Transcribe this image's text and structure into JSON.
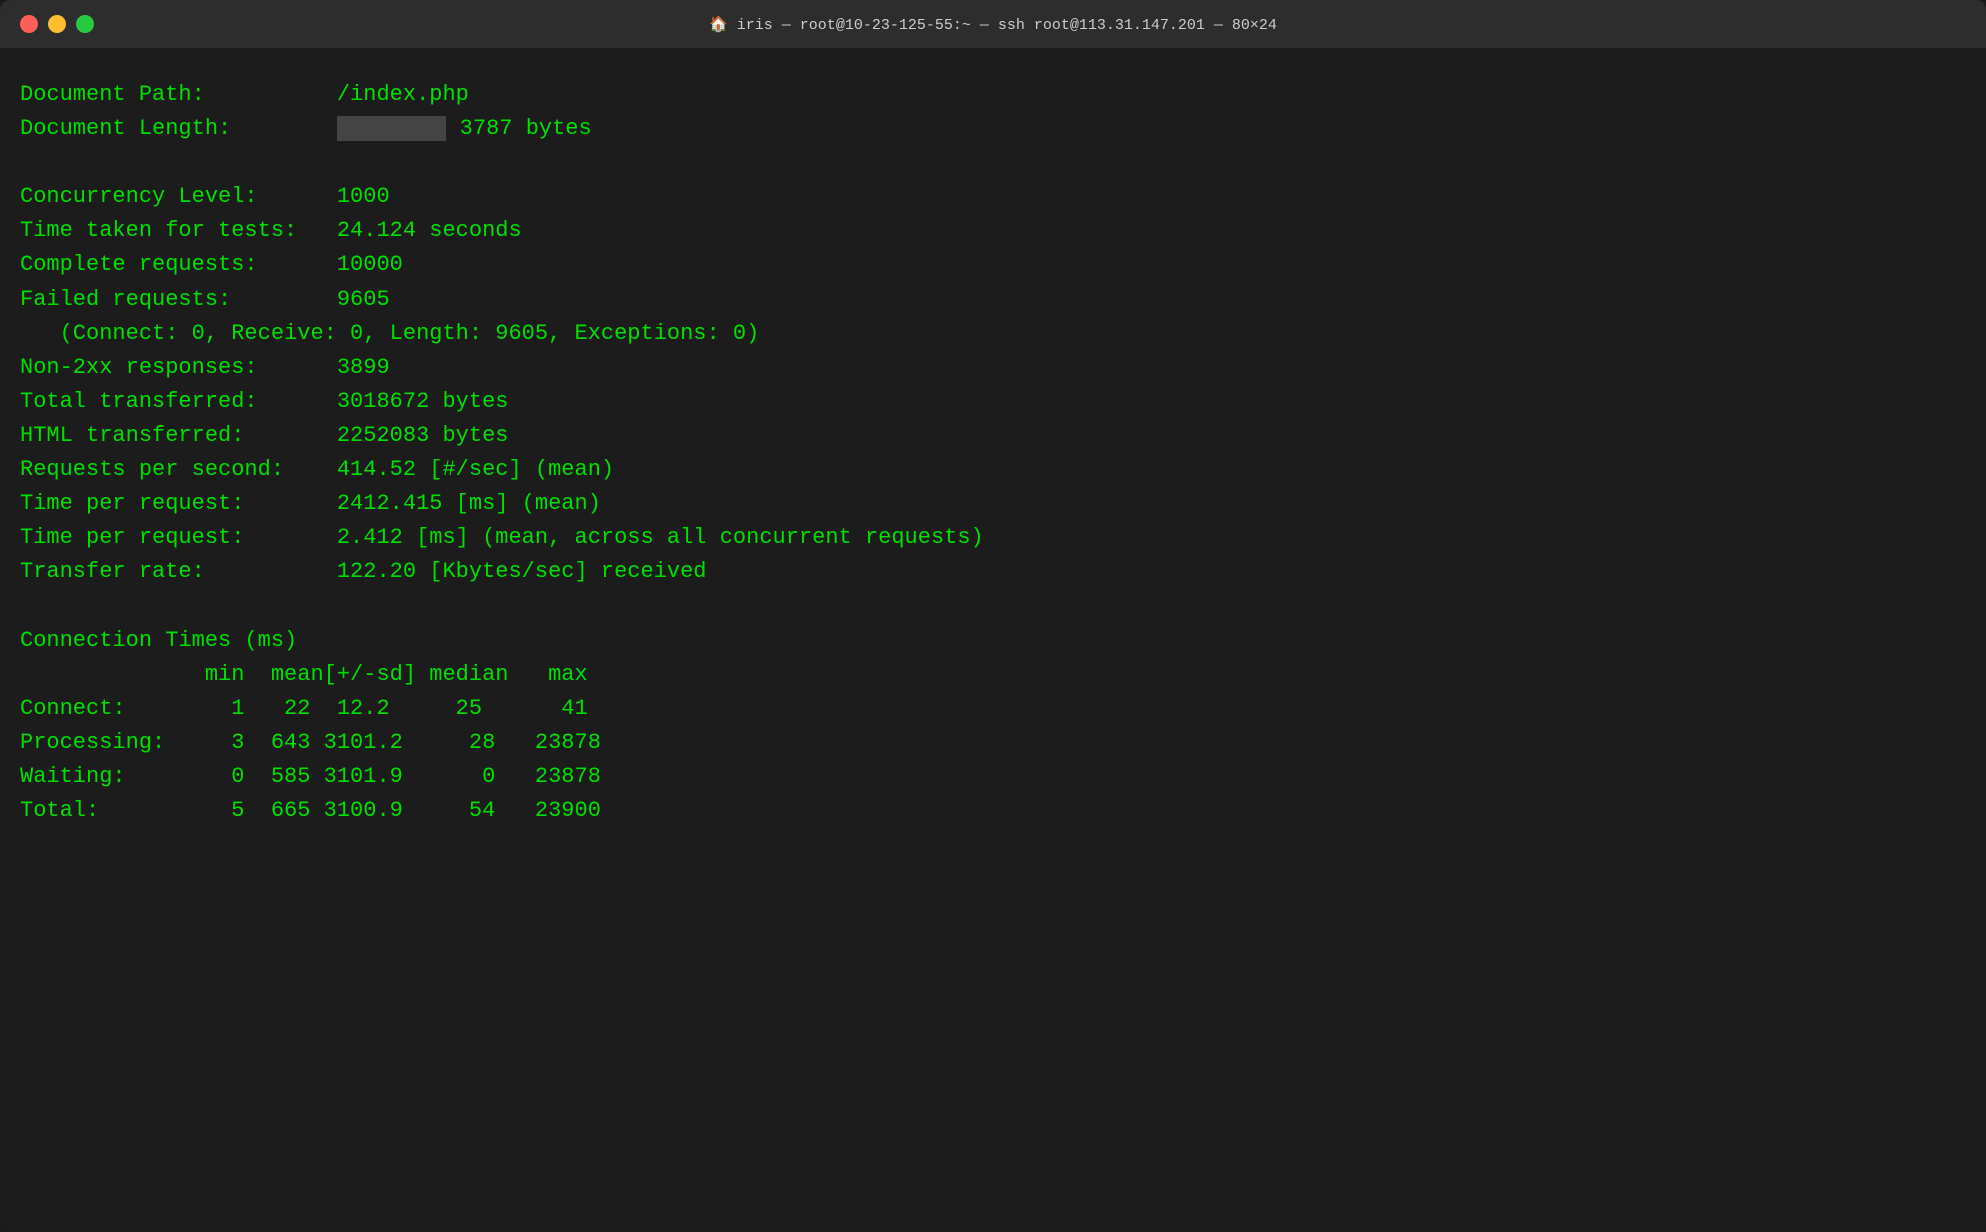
{
  "titlebar": {
    "title": "iris — root@10-23-125-55:~ — ssh root@113.31.147.201 — 80×24"
  },
  "terminal": {
    "lines": [
      {
        "id": "doc-path-label",
        "text": "Document Path:          /index.php"
      },
      {
        "id": "doc-length-label",
        "text": "Document Length:        3787 bytes",
        "redacted": true
      },
      {
        "id": "blank1",
        "blank": true
      },
      {
        "id": "concurrency-level",
        "text": "Concurrency Level:      1000"
      },
      {
        "id": "time-taken",
        "text": "Time taken for tests:   24.124 seconds"
      },
      {
        "id": "complete-requests",
        "text": "Complete requests:      10000"
      },
      {
        "id": "failed-requests",
        "text": "Failed requests:        9605"
      },
      {
        "id": "connect-breakdown",
        "text": "   (Connect: 0, Receive: 0, Length: 9605, Exceptions: 0)"
      },
      {
        "id": "non-2xx",
        "text": "Non-2xx responses:      3899"
      },
      {
        "id": "total-transferred",
        "text": "Total transferred:      3018672 bytes"
      },
      {
        "id": "html-transferred",
        "text": "HTML transferred:       2252083 bytes"
      },
      {
        "id": "requests-per-second",
        "text": "Requests per second:    414.52 [#/sec] (mean)"
      },
      {
        "id": "time-per-request-1",
        "text": "Time per request:       2412.415 [ms] (mean)"
      },
      {
        "id": "time-per-request-2",
        "text": "Time per request:       2.412 [ms] (mean, across all concurrent requests)"
      },
      {
        "id": "transfer-rate",
        "text": "Transfer rate:          122.20 [Kbytes/sec] received"
      },
      {
        "id": "blank2",
        "blank": true
      },
      {
        "id": "connection-times-header",
        "text": "Connection Times (ms)"
      },
      {
        "id": "ct-column-headers",
        "text": "              min  mean[+/-sd] median   max"
      },
      {
        "id": "ct-connect",
        "text": "Connect:        1   22  12.2     25      41"
      },
      {
        "id": "ct-processing",
        "text": "Processing:     3  643 3101.2     28   23878"
      },
      {
        "id": "ct-waiting",
        "text": "Waiting:        0  585 3101.9      0   23878"
      },
      {
        "id": "ct-total",
        "text": "Total:          5  665 3100.9     54   23900"
      }
    ]
  }
}
